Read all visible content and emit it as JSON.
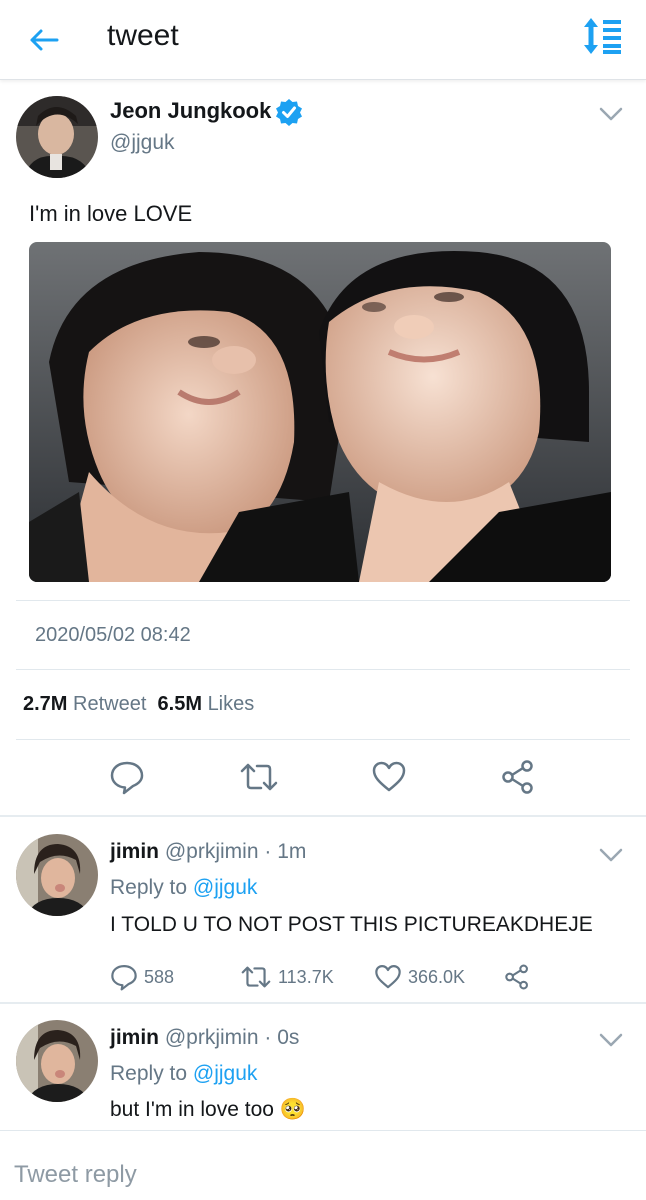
{
  "header": {
    "title": "tweet",
    "back_icon": "arrow-left-icon",
    "sort_icon": "sort-icon",
    "accent": "#1da1f2"
  },
  "tweet": {
    "author_name": "Jeon Jungkook",
    "author_handle": "@jjguk",
    "verified": true,
    "text": "I'm in love LOVE",
    "timestamp": "2020/05/02 08:42",
    "retweets_count": "2.7M",
    "retweets_label": "Retweet",
    "likes_count": "6.5M",
    "likes_label": "Likes",
    "actions": [
      "reply-icon",
      "retweet-icon",
      "like-icon",
      "share-icon"
    ]
  },
  "replies": [
    {
      "name": "jimin",
      "handle": "@prkjimin",
      "time": "· 1m",
      "reply_prefix": "Reply to",
      "reply_to": "@jjguk",
      "text": "I TOLD U TO NOT POST THIS PICTUREAKDHEJE",
      "reply_count": "588",
      "retweet_count": "113.7K",
      "like_count": "366.0K"
    },
    {
      "name": "jimin",
      "handle": "@prkjimin",
      "time": "· 0s",
      "reply_prefix": "Reply to",
      "reply_to": "@jjguk",
      "text": "but I'm in love too",
      "emoji": "🥺"
    }
  ],
  "compose": {
    "placeholder": "Tweet reply"
  }
}
